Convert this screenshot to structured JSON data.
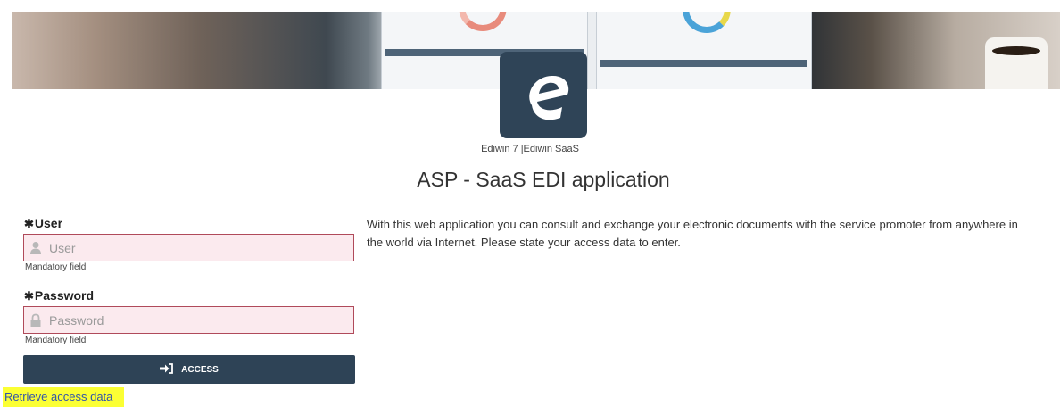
{
  "header": {
    "product_line": "Ediwin 7 |Ediwin SaaS",
    "app_title": "ASP - SaaS EDI application"
  },
  "intro_text": "With this web application you can consult and exchange your electronic documents with the service promoter from anywhere in the world via Internet. Please state your access data to enter.",
  "form": {
    "user": {
      "required_mark": "✱",
      "label": "User",
      "placeholder": "User",
      "value": "",
      "hint": "Mandatory field",
      "icon": "user-icon"
    },
    "password": {
      "required_mark": "✱",
      "label": "Password",
      "placeholder": "Password",
      "value": "",
      "hint": "Mandatory field",
      "icon": "lock-icon"
    },
    "access_button": {
      "label": "ACCESS",
      "icon": "sign-in-icon"
    },
    "retrieve_link": "Retrieve access data"
  },
  "colors": {
    "primary": "#2e4356",
    "invalid_border": "#b04a5a",
    "invalid_bg": "#fbeaee",
    "highlight": "#fbff34",
    "link": "#3355aa"
  }
}
